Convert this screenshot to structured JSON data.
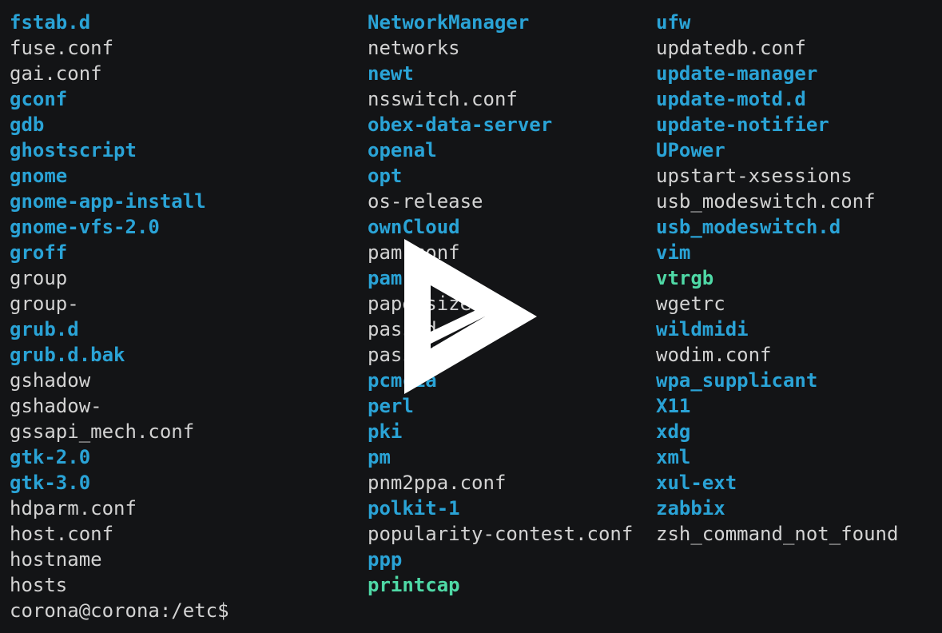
{
  "columns": [
    [
      {
        "name": "fstab.d",
        "kind": "dir"
      },
      {
        "name": "fuse.conf",
        "kind": "file"
      },
      {
        "name": "gai.conf",
        "kind": "file"
      },
      {
        "name": "gconf",
        "kind": "dir"
      },
      {
        "name": "gdb",
        "kind": "dir"
      },
      {
        "name": "ghostscript",
        "kind": "dir"
      },
      {
        "name": "gnome",
        "kind": "dir"
      },
      {
        "name": "gnome-app-install",
        "kind": "dir"
      },
      {
        "name": "gnome-vfs-2.0",
        "kind": "dir"
      },
      {
        "name": "groff",
        "kind": "dir"
      },
      {
        "name": "group",
        "kind": "file"
      },
      {
        "name": "group-",
        "kind": "file"
      },
      {
        "name": "grub.d",
        "kind": "dir"
      },
      {
        "name": "grub.d.bak",
        "kind": "dir"
      },
      {
        "name": "gshadow",
        "kind": "file"
      },
      {
        "name": "gshadow-",
        "kind": "file"
      },
      {
        "name": "gssapi_mech.conf",
        "kind": "file"
      },
      {
        "name": "gtk-2.0",
        "kind": "dir"
      },
      {
        "name": "gtk-3.0",
        "kind": "dir"
      },
      {
        "name": "hdparm.conf",
        "kind": "file"
      },
      {
        "name": "host.conf",
        "kind": "file"
      },
      {
        "name": "hostname",
        "kind": "file"
      },
      {
        "name": "hosts",
        "kind": "file"
      }
    ],
    [
      {
        "name": "NetworkManager",
        "kind": "dir"
      },
      {
        "name": "networks",
        "kind": "file"
      },
      {
        "name": "newt",
        "kind": "dir"
      },
      {
        "name": "nsswitch.conf",
        "kind": "file"
      },
      {
        "name": "obex-data-server",
        "kind": "dir"
      },
      {
        "name": "openal",
        "kind": "dir"
      },
      {
        "name": "opt",
        "kind": "dir"
      },
      {
        "name": "os-release",
        "kind": "file"
      },
      {
        "name": "ownCloud",
        "kind": "dir"
      },
      {
        "name": "pam.conf",
        "kind": "file"
      },
      {
        "name": "pam.d",
        "kind": "dir"
      },
      {
        "name": "papersize",
        "kind": "file"
      },
      {
        "name": "passwd",
        "kind": "file"
      },
      {
        "name": "passwd-",
        "kind": "file"
      },
      {
        "name": "pcmcia",
        "kind": "dir"
      },
      {
        "name": "perl",
        "kind": "dir"
      },
      {
        "name": "pki",
        "kind": "dir"
      },
      {
        "name": "pm",
        "kind": "dir"
      },
      {
        "name": "pnm2ppa.conf",
        "kind": "file"
      },
      {
        "name": "polkit-1",
        "kind": "dir"
      },
      {
        "name": "popularity-contest.conf",
        "kind": "file"
      },
      {
        "name": "ppp",
        "kind": "dir"
      },
      {
        "name": "printcap",
        "kind": "link"
      }
    ],
    [
      {
        "name": "ufw",
        "kind": "dir"
      },
      {
        "name": "updatedb.conf",
        "kind": "file"
      },
      {
        "name": "update-manager",
        "kind": "dir"
      },
      {
        "name": "update-motd.d",
        "kind": "dir"
      },
      {
        "name": "update-notifier",
        "kind": "dir"
      },
      {
        "name": "UPower",
        "kind": "dir"
      },
      {
        "name": "upstart-xsessions",
        "kind": "file"
      },
      {
        "name": "usb_modeswitch.conf",
        "kind": "file"
      },
      {
        "name": "usb_modeswitch.d",
        "kind": "dir"
      },
      {
        "name": "vim",
        "kind": "dir"
      },
      {
        "name": "vtrgb",
        "kind": "link"
      },
      {
        "name": "wgetrc",
        "kind": "file"
      },
      {
        "name": "wildmidi",
        "kind": "dir"
      },
      {
        "name": "wodim.conf",
        "kind": "file"
      },
      {
        "name": "wpa_supplicant",
        "kind": "dir"
      },
      {
        "name": "X11",
        "kind": "dir"
      },
      {
        "name": "xdg",
        "kind": "dir"
      },
      {
        "name": "xml",
        "kind": "dir"
      },
      {
        "name": "xul-ext",
        "kind": "dir"
      },
      {
        "name": "zabbix",
        "kind": "dir"
      },
      {
        "name": "zsh_command_not_found",
        "kind": "file"
      }
    ]
  ],
  "prompt": "corona@corona:/etc$",
  "colors": {
    "background": "#131416",
    "file": "#d3d3d3",
    "directory": "#2aa3d6",
    "symlink": "#4fd9a6",
    "logo": "#ffffff"
  },
  "overlay_icon": "asciinema-play-logo-icon"
}
